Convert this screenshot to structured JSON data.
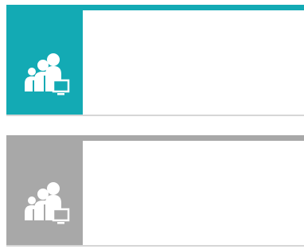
{
  "tiles": [
    {
      "id": "tile-1",
      "accent_color": "#13aab4",
      "icon": "users-monitor-icon",
      "label": ""
    },
    {
      "id": "tile-2",
      "accent_color": "#a8a8a8",
      "icon": "users-monitor-icon",
      "label": ""
    }
  ]
}
